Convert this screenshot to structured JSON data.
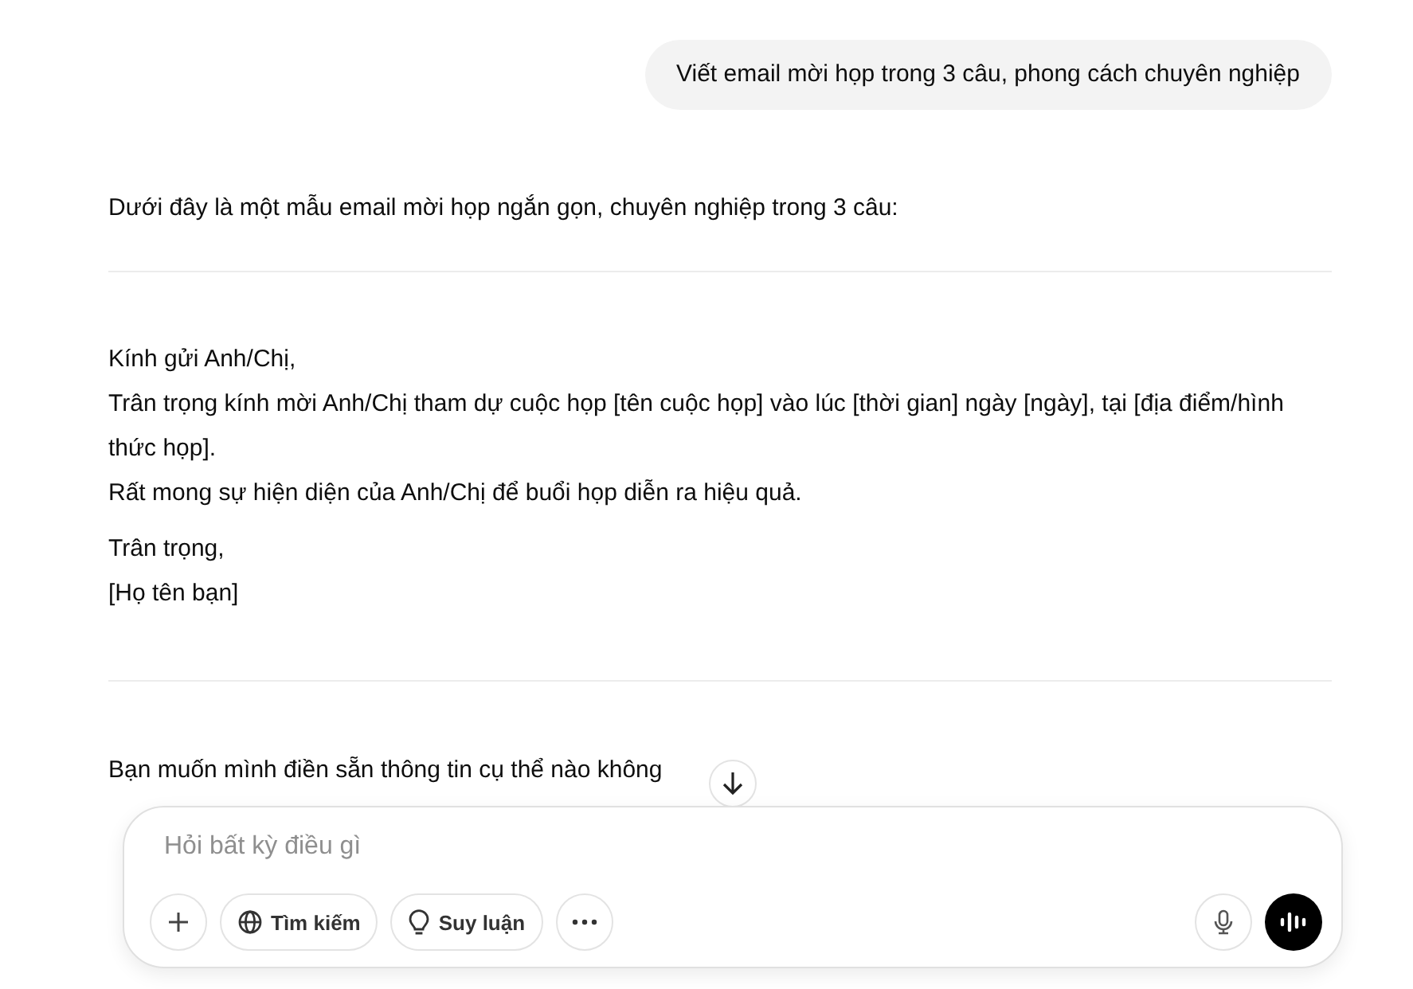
{
  "user_message": "Viết email mời họp trong 3 câu, phong cách chuyên nghiệp",
  "reply": {
    "intro": "Dưới đây là một mẫu email mời họp ngắn gọn, chuyên nghiệp trong 3 câu:",
    "email_paragraphs": [
      [
        "Kính gửi Anh/Chị,",
        "Trân trọng kính mời Anh/Chị tham dự cuộc họp [tên cuộc họp] vào lúc [thời gian] ngày [ngày], tại [địa điểm/hình thức họp].",
        "Rất mong sự hiện diện của Anh/Chị để buổi họp diễn ra hiệu quả."
      ],
      [
        "Trân trọng,",
        "[Họ tên bạn]"
      ]
    ],
    "question": "Bạn muốn mình điền sẵn thông tin cụ thể nào không"
  },
  "composer": {
    "placeholder": "Hỏi bất kỳ điều gì",
    "tools": [
      {
        "kind": "add"
      },
      {
        "kind": "search",
        "label": "Tìm kiếm"
      },
      {
        "kind": "reason",
        "label": "Suy luận"
      },
      {
        "kind": "more"
      }
    ]
  }
}
